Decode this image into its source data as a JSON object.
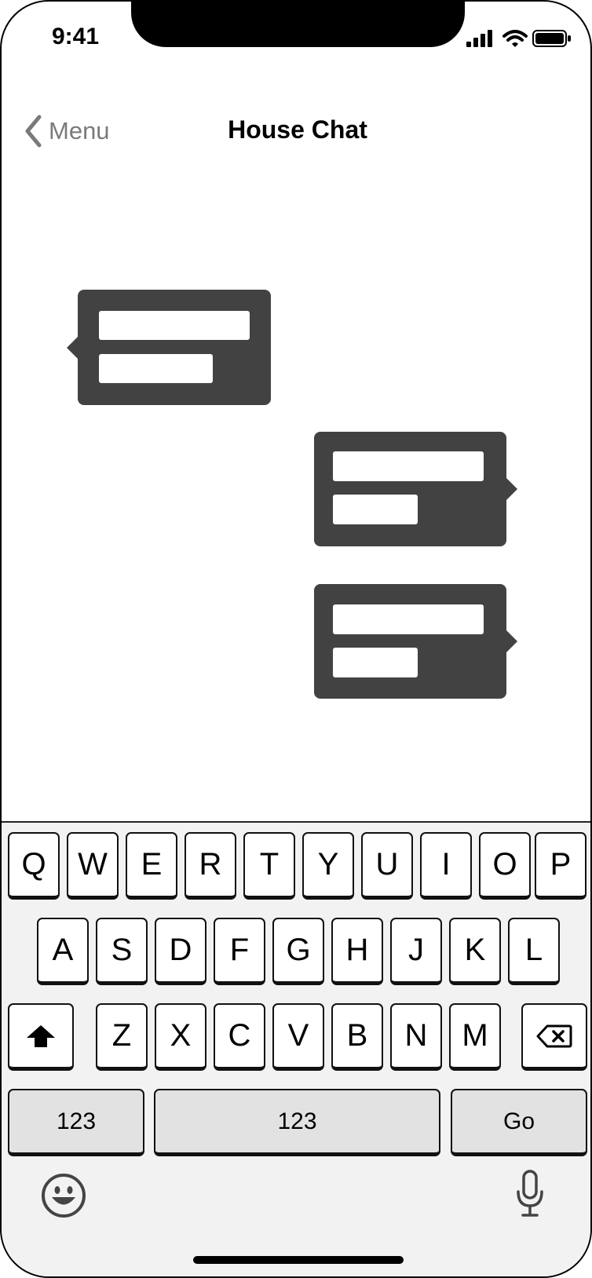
{
  "status_bar": {
    "time": "9:41",
    "icons": [
      "cellular-signal-icon",
      "wifi-icon",
      "battery-icon"
    ]
  },
  "nav": {
    "back_label": "Menu",
    "back_icon": "chevron-left-icon",
    "title": "House Chat"
  },
  "messages": [
    {
      "direction": "incoming",
      "lines": 2
    },
    {
      "direction": "outgoing",
      "lines": 2
    },
    {
      "direction": "outgoing",
      "lines": 2
    }
  ],
  "keyboard": {
    "row1": [
      "Q",
      "W",
      "E",
      "R",
      "T",
      "Y",
      "U",
      "I",
      "O",
      "P"
    ],
    "row2": [
      "A",
      "S",
      "D",
      "F",
      "G",
      "H",
      "J",
      "K",
      "L"
    ],
    "row3": [
      "Z",
      "X",
      "C",
      "V",
      "B",
      "N",
      "M"
    ],
    "shift_icon": "shift-arrow-icon",
    "delete_icon": "backspace-icon",
    "bottom": {
      "numbers_label": "123",
      "space_label": "123",
      "go_label": "Go"
    },
    "emoji_icon": "emoji-smiley-icon",
    "mic_icon": "microphone-icon"
  },
  "colors": {
    "bubble": "#424242",
    "keyboard_bg": "#f2f2f2",
    "function_key": "#e2e2e2",
    "nav_back": "#7a7a7a"
  }
}
